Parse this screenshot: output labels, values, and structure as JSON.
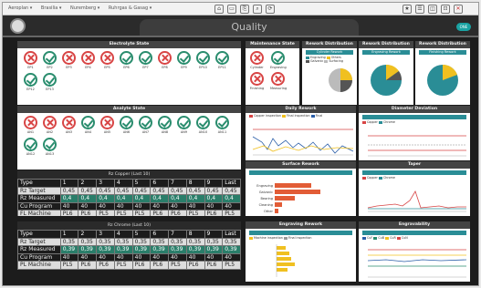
{
  "topbar": {
    "crumbs": [
      "Aeroplan ▾",
      "Brasilia ▾",
      "Nuremberg ▾",
      "Ruhrgas & Gasag ▾"
    ],
    "tools": [
      "⌂",
      "▭",
      "⎘",
      "⌕",
      "⟳"
    ],
    "right_tools": [
      "★",
      "☰",
      "◫",
      "⊡",
      "✕"
    ]
  },
  "header": {
    "title": "Quality",
    "badge": "ONE"
  },
  "electrolyte": {
    "title": "Electrolyte State",
    "items": [
      {
        "label": "EP1",
        "state": "bad"
      },
      {
        "label": "EP2",
        "state": "good"
      },
      {
        "label": "EP3",
        "state": "bad"
      },
      {
        "label": "EP4",
        "state": "bad"
      },
      {
        "label": "EP5",
        "state": "bad"
      },
      {
        "label": "EP6",
        "state": "good"
      },
      {
        "label": "EP7",
        "state": "good"
      },
      {
        "label": "EP8",
        "state": "bad"
      },
      {
        "label": "EP9",
        "state": "good"
      },
      {
        "label": "EP10",
        "state": "good"
      },
      {
        "label": "EP11",
        "state": "good"
      },
      {
        "label": "EP12",
        "state": "good"
      },
      {
        "label": "EP13",
        "state": "good"
      }
    ]
  },
  "analyte": {
    "title": "Analyte State",
    "items": [
      {
        "label": "AN1",
        "state": "bad"
      },
      {
        "label": "AN2",
        "state": "bad"
      },
      {
        "label": "AN3",
        "state": "bad"
      },
      {
        "label": "AN4",
        "state": "good"
      },
      {
        "label": "AN5",
        "state": "bad"
      },
      {
        "label": "AN6",
        "state": "good"
      },
      {
        "label": "AN7",
        "state": "good"
      },
      {
        "label": "AN8",
        "state": "good"
      },
      {
        "label": "AN9",
        "state": "good"
      },
      {
        "label": "AN10",
        "state": "good"
      },
      {
        "label": "AN11",
        "state": "good"
      },
      {
        "label": "AN12",
        "state": "good"
      },
      {
        "label": "AN13",
        "state": "good"
      }
    ]
  },
  "rz_copper": {
    "title": "Rz Copper (Last 10)",
    "header": [
      "Type",
      "1",
      "2",
      "3",
      "4",
      "5",
      "6",
      "7",
      "8",
      "9",
      "Last"
    ],
    "rows": [
      [
        "Rz Target",
        "0,45",
        "0,45",
        "0,45",
        "0,45",
        "0,45",
        "0,45",
        "0,45",
        "0,45",
        "0,45",
        "0,45"
      ],
      [
        "Rz Measured",
        "0,4",
        "0,4",
        "0,4",
        "0,4",
        "0,4",
        "0,4",
        "0,4",
        "0,4",
        "0,4",
        "0,4"
      ],
      [
        "Cu Program",
        "40",
        "40",
        "40",
        "40",
        "40",
        "40",
        "40",
        "40",
        "40",
        "40"
      ],
      [
        "FL Machine",
        "PL6",
        "PL6",
        "PL5",
        "PL5",
        "PL5",
        "PL6",
        "PL6",
        "PL5",
        "PL6",
        "PL5"
      ]
    ]
  },
  "rz_chrome": {
    "title": "Rz Chrome (Last 10)",
    "header": [
      "Type",
      "1",
      "2",
      "3",
      "4",
      "5",
      "6",
      "7",
      "8",
      "9",
      "Last"
    ],
    "rows": [
      [
        "Rz Target",
        "0,35",
        "0,35",
        "0,35",
        "0,35",
        "0,35",
        "0,35",
        "0,35",
        "0,35",
        "0,35",
        "0,35"
      ],
      [
        "Rz Measured",
        "0,39",
        "0,39",
        "0,39",
        "0,39",
        "0,39",
        "0,39",
        "0,39",
        "0,39",
        "0,39",
        "0,39"
      ],
      [
        "Cu Program",
        "40",
        "40",
        "40",
        "40",
        "40",
        "40",
        "40",
        "40",
        "40",
        "40"
      ],
      [
        "PL Machine",
        "PL5",
        "PL6",
        "PL6",
        "PL5",
        "PL6",
        "PL6",
        "PL5",
        "PL6",
        "PL6",
        "PL5"
      ]
    ]
  },
  "maintenance": {
    "title": "Maintenance State",
    "items": [
      {
        "label": "Cylinder",
        "state": "bad"
      },
      {
        "label": "Engraving",
        "state": "good"
      },
      {
        "label": "Finishing",
        "state": "bad"
      },
      {
        "label": "Measuring",
        "state": "bad"
      }
    ]
  },
  "rework_dist": [
    {
      "title": "Rework Distribution",
      "sub": "Cylinder Rework"
    },
    {
      "title": "Rework Distribution",
      "sub": "Engraving Rework"
    },
    {
      "title": "Rework Distribution",
      "sub": "Finishing Rework"
    }
  ],
  "dist_legend": [
    "Engraving",
    "Others",
    "Galvanic",
    "Surfacing"
  ],
  "charts": {
    "daily": {
      "title": "Daily Rework",
      "legend": [
        "Copper inspection",
        "Final inspection",
        "Final"
      ]
    },
    "deviation": {
      "title": "Diameter Deviation",
      "legend": [
        "Copper",
        "Chrome"
      ]
    },
    "surface": {
      "title": "Surface Rework",
      "labels": [
        "Engraving",
        "Galvanic",
        "Bearing",
        "Cleaning",
        "Other"
      ]
    },
    "taper": {
      "title": "Taper",
      "legend": [
        "Copper",
        "Chrome"
      ]
    },
    "engraving": {
      "title": "Engraving Rework",
      "legend": [
        "Machine inspection",
        "Final inspection"
      ]
    },
    "engravability": {
      "title": "Engravability",
      "legend": [
        "CuF",
        "CuB",
        "CuR",
        "CuN"
      ]
    }
  },
  "colors": {
    "bad": "#d84545",
    "good": "#2a8d6e",
    "teal": "#2a8d96",
    "accent": "#f0c020"
  }
}
